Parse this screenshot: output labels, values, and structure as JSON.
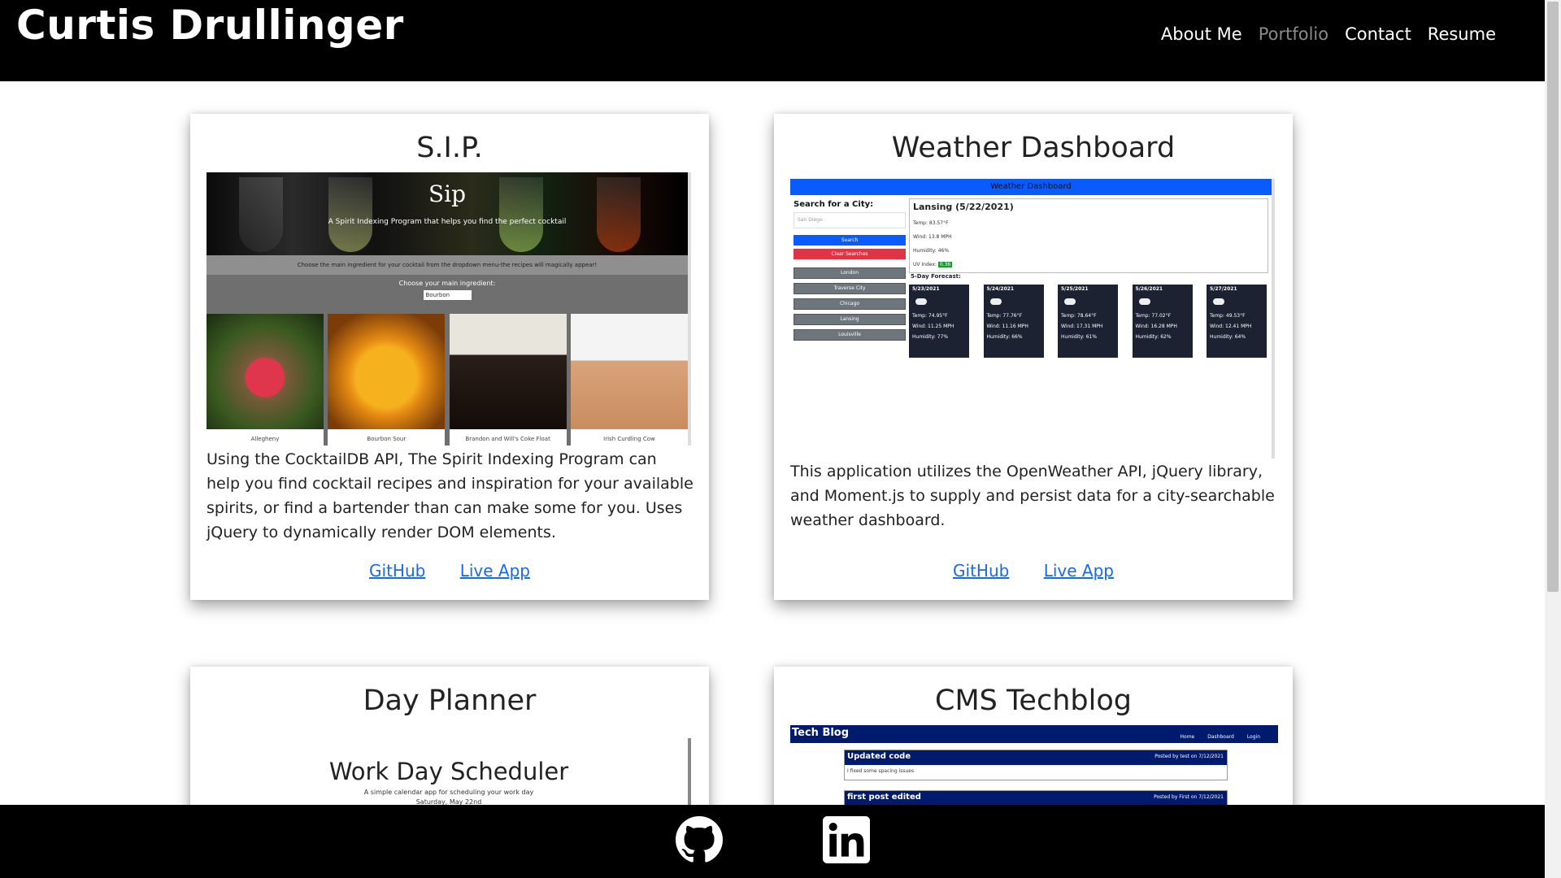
{
  "header": {
    "brand": "Curtis Drullinger",
    "nav": [
      "About Me",
      "Portfolio",
      "Contact",
      "Resume"
    ],
    "active": "Portfolio"
  },
  "projects": [
    {
      "title": "S.I.P.",
      "description": "Using the CocktailDB API, The Spirit Indexing Program can help you find cocktail recipes and inspiration for your available spirits, or find a bartender than can make some for you. Uses jQuery to dynamically render DOM elements.",
      "links": [
        "GitHub",
        "Live App"
      ],
      "screenshot": {
        "title": "Sip",
        "subtitle": "A Spirit Indexing Program that helps you find the perfect cocktail",
        "band": "Choose the main ingredient for your cocktail from the dropdown menu-the recipes will magically appear!",
        "choose_label": "Choose your main ingredient:",
        "select_value": "Bourbon",
        "drinks": [
          "Allegheny",
          "Bourbon Sour",
          "Brandon and Will's Coke Float",
          "Irish Curdling Cow"
        ]
      }
    },
    {
      "title": "Weather Dashboard",
      "description": "This application utilizes the OpenWeather API, jQuery library, and Moment.js to supply and persist data for a city-searchable weather dashboard.",
      "links": [
        "GitHub",
        "Live App"
      ],
      "screenshot": {
        "header": "Weather Dashboard",
        "search_label": "Search for a City:",
        "search_placeholder": "San Diego",
        "search_btn": "Search",
        "clear_btn": "Clear Searches",
        "history": [
          "London",
          "Traverse City",
          "Chicago",
          "Lansing",
          "Louisville"
        ],
        "current_city": "Lansing (5/22/2021)",
        "current": [
          "Temp: 83.57°F",
          "Wind: 13.8 MPH",
          "Humidity: 46%"
        ],
        "uv_label": "UV Index:",
        "uv_value": "0.36",
        "forecast_title": "5-Day Forecast:",
        "forecast": [
          {
            "date": "5/23/2021",
            "temp": "Temp: 74.95°F",
            "wind": "Wind: 11.25 MPH",
            "hum": "Humidity: 77%"
          },
          {
            "date": "5/24/2021",
            "temp": "Temp: 77.76°F",
            "wind": "Wind: 11.16 MPH",
            "hum": "Humidity: 66%"
          },
          {
            "date": "5/25/2021",
            "temp": "Temp: 78.64°F",
            "wind": "Wind: 17.31 MPH",
            "hum": "Humidity: 61%"
          },
          {
            "date": "5/26/2021",
            "temp": "Temp: 77.02°F",
            "wind": "Wind: 16.28 MPH",
            "hum": "Humidity: 62%"
          },
          {
            "date": "5/27/2021",
            "temp": "Temp: 49.53°F",
            "wind": "Wind: 12.41 MPH",
            "hum": "Humidity: 64%"
          }
        ]
      }
    },
    {
      "title": "Day Planner",
      "screenshot": {
        "title": "Work Day Scheduler",
        "subtitle": "A simple calendar app for scheduling your work day",
        "date": "Saturday, May 22nd"
      }
    },
    {
      "title": "CMS Techblog",
      "screenshot": {
        "brand": "Tech Blog",
        "nav": [
          "Home",
          "Dashboard",
          "Login"
        ],
        "posts": [
          {
            "title": "Updated code",
            "by": "Posted by test on 7/12/2021",
            "body": "I fixed some spacing issues"
          },
          {
            "title": "first post edited",
            "by": "Posted by First on 7/12/2021",
            "body": ""
          }
        ]
      }
    }
  ],
  "footer": {
    "icons": [
      "github-icon",
      "linkedin-icon"
    ]
  }
}
